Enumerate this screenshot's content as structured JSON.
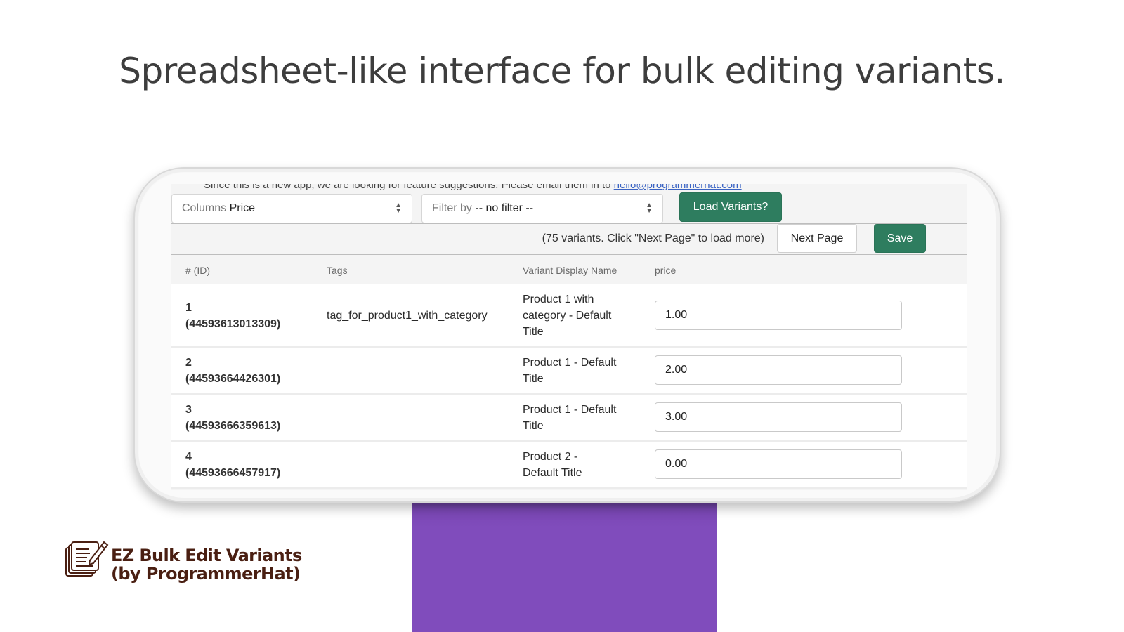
{
  "headline": "Spreadsheet-like interface for bulk editing variants.",
  "colors": {
    "accent_green": "#2e7d5f",
    "purple_block": "#804cbc",
    "brand_text": "#4a1f12"
  },
  "app": {
    "notice": {
      "text": "Since this is a new app, we are looking for feature suggestions. Please email them in to ",
      "link": "hello@programmerhat.com"
    },
    "toolbar": {
      "columns_select": {
        "label": "Columns",
        "value": "Price"
      },
      "filter_select": {
        "label": "Filter by",
        "value": "-- no filter --"
      },
      "load_button": "Load Variants?"
    },
    "pager": {
      "status": "(75 variants. Click \"Next Page\" to load more)",
      "next_button": "Next Page",
      "save_button": "Save"
    },
    "table": {
      "headers": [
        "# (ID)",
        "Tags",
        "Variant Display Name",
        "price"
      ],
      "rows": [
        {
          "num": "1",
          "id": "(44593613013309)",
          "tags": "tag_for_product1_with_category",
          "name": "Product 1 with category - Default Title",
          "price": "1.00"
        },
        {
          "num": "2",
          "id": "(44593664426301)",
          "tags": "",
          "name": "Product 1 - Default Title",
          "price": "2.00"
        },
        {
          "num": "3",
          "id": "(44593666359613)",
          "tags": "",
          "name": "Product 1 - Default Title",
          "price": "3.00"
        },
        {
          "num": "4",
          "id": "(44593666457917)",
          "tags": "",
          "name": "Product 2 - Default Title",
          "price": "0.00"
        }
      ]
    }
  },
  "brand": {
    "icon": "notepad-pencil-icon",
    "line1": "EZ Bulk Edit Variants",
    "line2": "(by ProgrammerHat)"
  }
}
